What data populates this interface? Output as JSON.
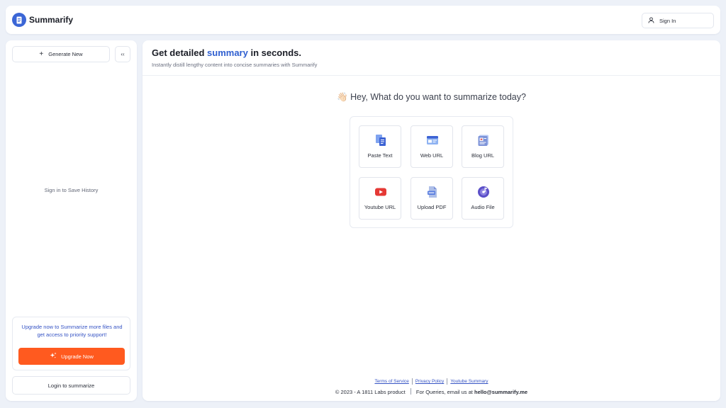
{
  "app": {
    "name": "Summarify"
  },
  "header": {
    "sign_in_label": "Sign In"
  },
  "sidebar": {
    "generate_new_label": "Generate New",
    "collapse_glyph": "‹‹",
    "history_note": "Sign in to Save History",
    "upgrade_text": "Upgrade now to Summarize more files and get access to priority support!",
    "upgrade_button_label": "Upgrade Now",
    "login_label": "Login to summarize"
  },
  "main": {
    "headline": {
      "before": "Get detailed ",
      "accent": "summary",
      "after": " in seconds."
    },
    "subheading": "Instantly distill lengthy content into concise summaries with Summarify",
    "greeting_emoji": "👋🏻",
    "greeting": "Hey, What do you want to summarize today?",
    "options": [
      {
        "label": "Paste Text",
        "icon": "paste-text-icon"
      },
      {
        "label": "Web URL",
        "icon": "web-url-icon"
      },
      {
        "label": "Blog URL",
        "icon": "blog-url-icon"
      },
      {
        "label": "Youtube URL",
        "icon": "youtube-icon"
      },
      {
        "label": "Upload PDF",
        "icon": "pdf-icon"
      },
      {
        "label": "Audio File",
        "icon": "audio-file-icon"
      }
    ]
  },
  "footer": {
    "links": [
      "Terms of Service",
      "Privacy Policy",
      "Youtube Summary"
    ],
    "copyright": "© 2023 - A 1811 Labs product",
    "queries_prefix": "For Queries, email us at ",
    "email": "hello@summarify.me"
  },
  "colors": {
    "brand": "#3b66d6",
    "accent_text": "#2f5fd0",
    "upgrade_button": "#ff5a1f",
    "page_background": "#edf1f8"
  }
}
